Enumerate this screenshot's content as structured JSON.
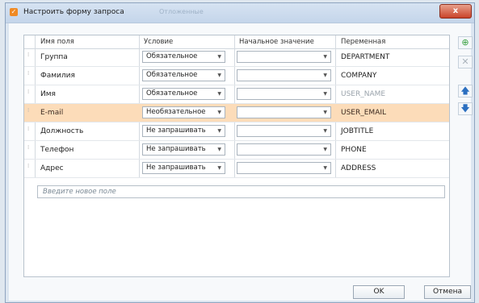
{
  "window": {
    "title": "Настроить форму запроса",
    "ghost_title": "Отложенные",
    "close_label": "x"
  },
  "columns": {
    "name": "Имя поля",
    "condition": "Условие",
    "initial": "Начальное значение",
    "variable": "Переменная"
  },
  "rows": [
    {
      "name": "Группа",
      "condition": "Обязательное",
      "initial": "",
      "variable": "DEPARTMENT",
      "selected": false,
      "dim": false
    },
    {
      "name": "Фамилия",
      "condition": "Обязательное",
      "initial": "",
      "variable": "COMPANY",
      "selected": false,
      "dim": false
    },
    {
      "name": "Имя",
      "condition": "Обязательное",
      "initial": "",
      "variable": "USER_NAME",
      "selected": false,
      "dim": true
    },
    {
      "name": "E-mail",
      "condition": "Необязательное",
      "initial": "",
      "variable": "USER_EMAIL",
      "selected": true,
      "dim": true
    },
    {
      "name": "Должность",
      "condition": "Не запрашивать",
      "initial": "",
      "variable": "JOBTITLE",
      "selected": false,
      "dim": false
    },
    {
      "name": "Телефон",
      "condition": "Не запрашивать",
      "initial": "",
      "variable": "PHONE",
      "selected": false,
      "dim": false
    },
    {
      "name": "Адрес",
      "condition": "Не запрашивать",
      "initial": "",
      "variable": "ADDRESS",
      "selected": false,
      "dim": false
    }
  ],
  "new_field_placeholder": "Введите новое поле",
  "side_buttons": {
    "add": "plus-icon",
    "remove": "x-icon",
    "up": "arrow-up-icon",
    "down": "arrow-down-icon"
  },
  "buttons": {
    "ok": "OK",
    "cancel": "Отмена"
  },
  "colors": {
    "selected_row": "#fcdcb9",
    "accent": "#2b6fc0",
    "add_green": "#3aa142"
  }
}
